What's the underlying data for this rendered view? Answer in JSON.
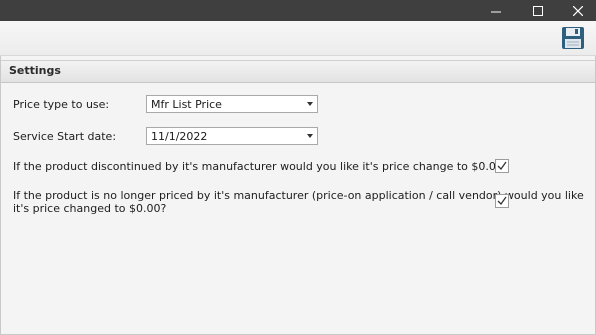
{
  "window": {
    "minimize_glyph": "minimize-icon",
    "maximize_glyph": "maximize-icon",
    "close_glyph": "close-icon"
  },
  "toolbar": {
    "save_icon": "floppy-disk-icon"
  },
  "settings": {
    "header": "Settings",
    "price_type_label": "Price type to use:",
    "price_type_value": "Mfr List Price",
    "service_start_label": "Service Start date:",
    "service_start_value": "11/1/2022",
    "discontinued_question": "If the product discontinued by it's manufacturer would you like it's price change to $0.00?",
    "discontinued_checked": true,
    "no_longer_priced_question_line1": "If the product is no longer priced by it's manufacturer (price-on application / call vendor) would you like",
    "no_longer_priced_question_line2": "it's price changed to $0.00?",
    "no_longer_priced_checked": true
  },
  "colors": {
    "titlebar": "#3f3f3f",
    "panel": "#f4f4f4",
    "save_icon": "#2f5f7f"
  }
}
